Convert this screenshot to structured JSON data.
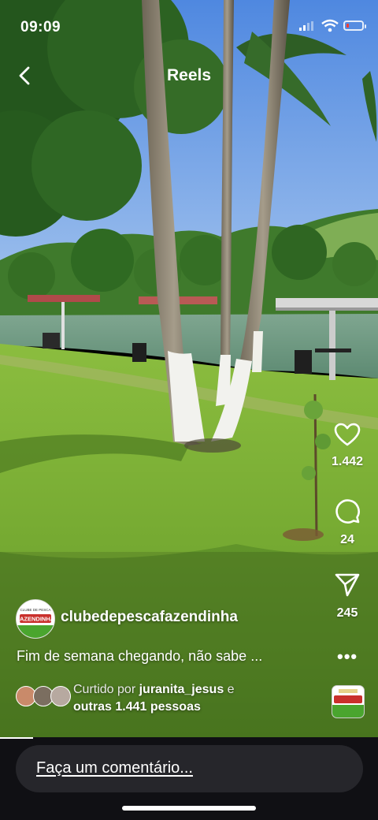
{
  "status_bar": {
    "time": "09:09",
    "battery_level": 0.15,
    "battery_color": "#ff3b30"
  },
  "header": {
    "title": "Reels",
    "back_icon": "chevron-left-icon"
  },
  "actions": {
    "likes": {
      "icon": "heart-icon",
      "count": "1.442"
    },
    "comments": {
      "icon": "comment-icon",
      "count": "24"
    },
    "shares": {
      "icon": "send-icon",
      "count": "245"
    },
    "more_icon": "more-horizontal-icon"
  },
  "post": {
    "username": "clubedepescafazendinha",
    "caption": "Fim de semana chegando, não sabe ...",
    "avatar_text": "FAZENDINHA",
    "avatar_small_text": "CLUBE DE PESCA"
  },
  "likes_line": {
    "prefix": "Curtido por",
    "user": "juranita_jesus",
    "connector": "e",
    "others": "outras 1.441 pessoas"
  },
  "comment_box": {
    "placeholder": "Faça um comentário..."
  },
  "colors": {
    "sky": "#6fa2e8",
    "grass": "#7fb33a",
    "lake": "#6f9a7e",
    "roof": "#b04a4a"
  }
}
